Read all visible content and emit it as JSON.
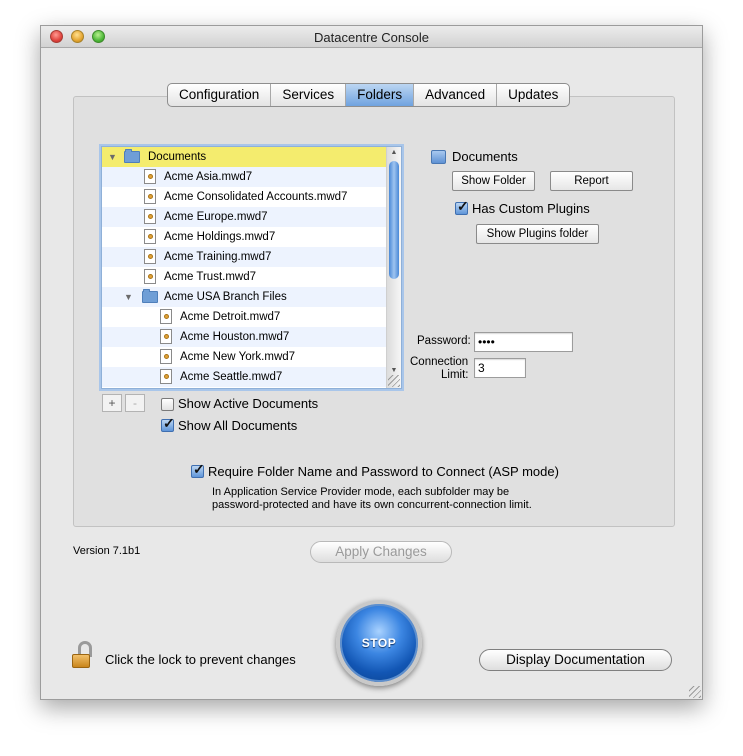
{
  "window": {
    "title": "Datacentre Console"
  },
  "tabs": [
    {
      "label": "Configuration",
      "selected": false
    },
    {
      "label": "Services",
      "selected": false
    },
    {
      "label": "Folders",
      "selected": true
    },
    {
      "label": "Advanced",
      "selected": false
    },
    {
      "label": "Updates",
      "selected": false
    }
  ],
  "outline": {
    "rows": [
      {
        "label": "Documents",
        "type": "folder",
        "expanded": true,
        "selected": true
      },
      {
        "label": "Acme Asia.mwd7",
        "type": "file"
      },
      {
        "label": "Acme Consolidated Accounts.mwd7",
        "type": "file"
      },
      {
        "label": "Acme Europe.mwd7",
        "type": "file"
      },
      {
        "label": "Acme Holdings.mwd7",
        "type": "file"
      },
      {
        "label": "Acme Training.mwd7",
        "type": "file"
      },
      {
        "label": "Acme Trust.mwd7",
        "type": "file"
      },
      {
        "label": "Acme USA Branch Files",
        "type": "folder",
        "expanded": true
      },
      {
        "label": "Acme Detroit.mwd7",
        "type": "file"
      },
      {
        "label": "Acme Houston.mwd7",
        "type": "file"
      },
      {
        "label": "Acme New York.mwd7",
        "type": "file"
      },
      {
        "label": "Acme Seattle.mwd7",
        "type": "file"
      }
    ],
    "add_label": "+",
    "remove_label": "-"
  },
  "options": {
    "show_active_label": "Show Active Documents",
    "show_active_checked": false,
    "show_all_label": "Show All Documents",
    "show_all_checked": true
  },
  "detail": {
    "folder_name": "Documents",
    "show_folder_label": "Show Folder",
    "report_label": "Report",
    "custom_plugins_label": "Has Custom Plugins",
    "custom_plugins_checked": true,
    "show_plugins_label": "Show Plugins folder",
    "password_label": "Password:",
    "password_value": "••••",
    "connection_label_1": "Connection",
    "connection_label_2": "Limit:",
    "connection_value": "3"
  },
  "asp": {
    "label": "Require Folder Name and Password to Connect (ASP mode)",
    "checked": true,
    "description_1": "In Application Service Provider mode, each subfolder may be",
    "description_2": "password-protected and have its own concurrent-connection limit."
  },
  "footer": {
    "version": "Version 7.1b1",
    "apply_label": "Apply Changes",
    "stop_label": "STOP",
    "lock_label": "Click the lock to prevent changes",
    "docs_label": "Display Documentation"
  }
}
